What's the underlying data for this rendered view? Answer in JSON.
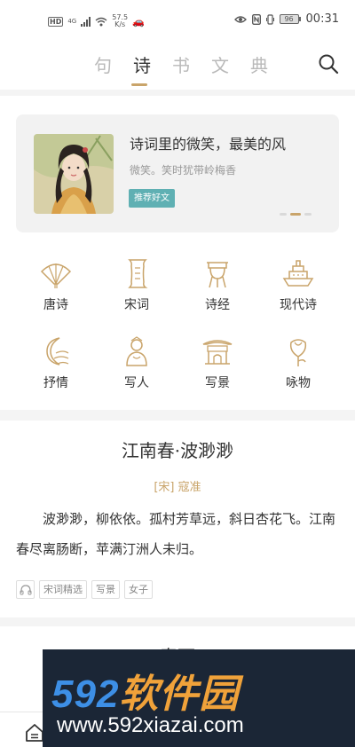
{
  "status_bar": {
    "hd": "HD",
    "network": "4G",
    "speed_value": "57.5",
    "speed_unit": "K/s",
    "battery": "96",
    "time": "00:31"
  },
  "nav": {
    "tabs": [
      {
        "label": "句",
        "active": false
      },
      {
        "label": "诗",
        "active": true
      },
      {
        "label": "书",
        "active": false
      },
      {
        "label": "文",
        "active": false
      },
      {
        "label": "典",
        "active": false
      }
    ],
    "search_icon": "search-icon"
  },
  "banner": {
    "title": "诗词里的微笑，最美的风",
    "subtitle": "微笑。笑时犹带岭梅香",
    "tag": "推荐好文",
    "page_count": 3,
    "active_page": 1
  },
  "categories": [
    {
      "label": "唐诗",
      "icon": "fan-icon"
    },
    {
      "label": "宋词",
      "icon": "scroll-icon"
    },
    {
      "label": "诗经",
      "icon": "ding-vessel-icon"
    },
    {
      "label": "现代诗",
      "icon": "ship-icon"
    },
    {
      "label": "抒情",
      "icon": "moon-icon"
    },
    {
      "label": "写人",
      "icon": "person-icon"
    },
    {
      "label": "写景",
      "icon": "pavilion-icon"
    },
    {
      "label": "咏物",
      "icon": "flower-icon"
    }
  ],
  "poem": {
    "title": "江南春·波渺渺",
    "author": "[宋] 寇准",
    "body": "波渺渺，柳依依。孤村芳草远，斜日杏花飞。江南春尽离肠断，苹满汀洲人未归。",
    "tags": [
      "宋词精选",
      "写景",
      "女子"
    ]
  },
  "next_poem": {
    "title": "春雨"
  },
  "bottom_bar": {
    "home_icon": "home-icon"
  },
  "watermark": {
    "brand_number": "592",
    "brand_text": "软件园",
    "url": "www.592xiazai.com"
  },
  "colors": {
    "accent_gold": "#c9a46a",
    "tag_teal": "#5fb0b3",
    "watermark_blue": "#3d8fe6",
    "watermark_orange": "#f0a23a"
  }
}
